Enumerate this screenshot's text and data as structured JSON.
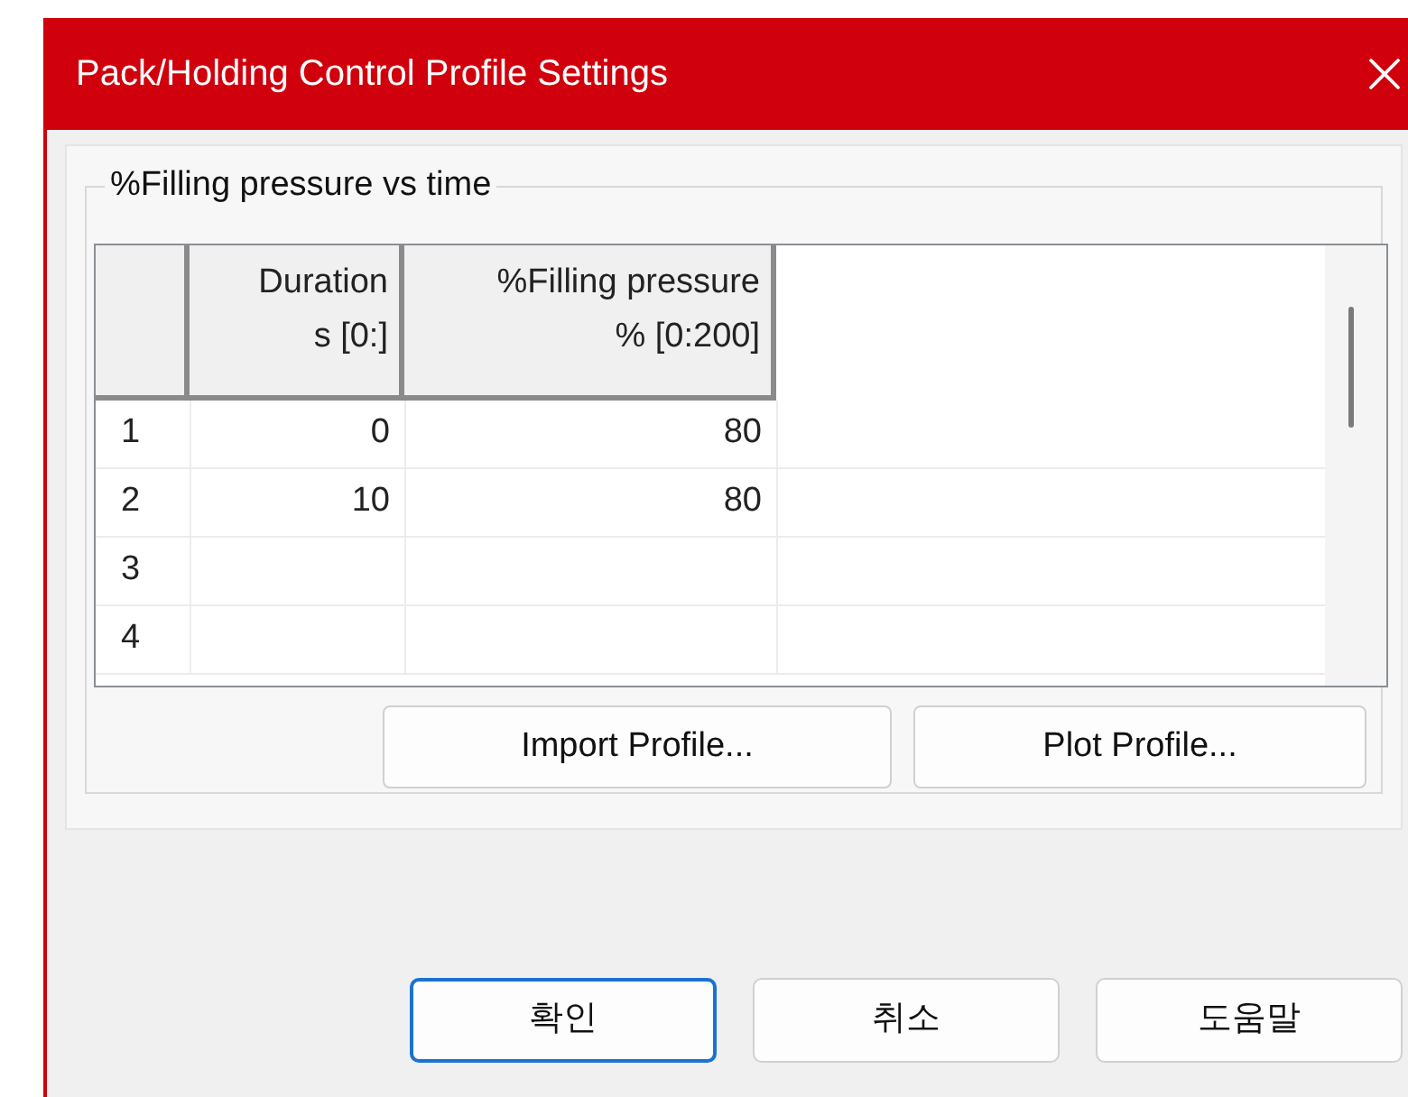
{
  "window": {
    "title": "Pack/Holding Control Profile Settings"
  },
  "group": {
    "title": "%Filling pressure vs time"
  },
  "table": {
    "columns": [
      {
        "lines": [
          "Duration",
          "s [0:]"
        ]
      },
      {
        "lines": [
          "%Filling pressure",
          "% [0:200]"
        ]
      }
    ],
    "rows": [
      {
        "index": "1",
        "cells": [
          "0",
          "80"
        ]
      },
      {
        "index": "2",
        "cells": [
          "10",
          "80"
        ]
      },
      {
        "index": "3",
        "cells": []
      },
      {
        "index": "4",
        "cells": []
      }
    ]
  },
  "group_buttons": [
    "Import Profile...",
    "Plot Profile..."
  ],
  "buttons": [
    {
      "label": "확인",
      "default": true
    },
    {
      "label": "취소",
      "default": false
    },
    {
      "label": "도움말",
      "default": false
    }
  ]
}
